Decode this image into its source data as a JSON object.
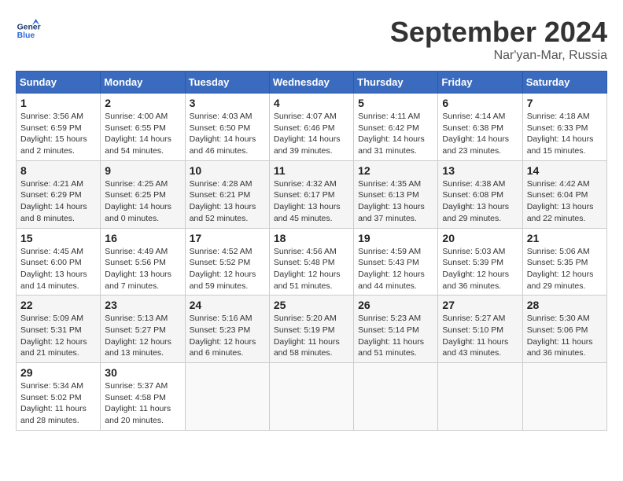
{
  "logo": {
    "text_general": "General",
    "text_blue": "Blue"
  },
  "header": {
    "month": "September 2024",
    "location": "Nar'yan-Mar, Russia"
  },
  "days_of_week": [
    "Sunday",
    "Monday",
    "Tuesday",
    "Wednesday",
    "Thursday",
    "Friday",
    "Saturday"
  ],
  "weeks": [
    [
      {
        "day": "1",
        "sunrise": "Sunrise: 3:56 AM",
        "sunset": "Sunset: 6:59 PM",
        "daylight": "Daylight: 15 hours and 2 minutes."
      },
      {
        "day": "2",
        "sunrise": "Sunrise: 4:00 AM",
        "sunset": "Sunset: 6:55 PM",
        "daylight": "Daylight: 14 hours and 54 minutes."
      },
      {
        "day": "3",
        "sunrise": "Sunrise: 4:03 AM",
        "sunset": "Sunset: 6:50 PM",
        "daylight": "Daylight: 14 hours and 46 minutes."
      },
      {
        "day": "4",
        "sunrise": "Sunrise: 4:07 AM",
        "sunset": "Sunset: 6:46 PM",
        "daylight": "Daylight: 14 hours and 39 minutes."
      },
      {
        "day": "5",
        "sunrise": "Sunrise: 4:11 AM",
        "sunset": "Sunset: 6:42 PM",
        "daylight": "Daylight: 14 hours and 31 minutes."
      },
      {
        "day": "6",
        "sunrise": "Sunrise: 4:14 AM",
        "sunset": "Sunset: 6:38 PM",
        "daylight": "Daylight: 14 hours and 23 minutes."
      },
      {
        "day": "7",
        "sunrise": "Sunrise: 4:18 AM",
        "sunset": "Sunset: 6:33 PM",
        "daylight": "Daylight: 14 hours and 15 minutes."
      }
    ],
    [
      {
        "day": "8",
        "sunrise": "Sunrise: 4:21 AM",
        "sunset": "Sunset: 6:29 PM",
        "daylight": "Daylight: 14 hours and 8 minutes."
      },
      {
        "day": "9",
        "sunrise": "Sunrise: 4:25 AM",
        "sunset": "Sunset: 6:25 PM",
        "daylight": "Daylight: 14 hours and 0 minutes."
      },
      {
        "day": "10",
        "sunrise": "Sunrise: 4:28 AM",
        "sunset": "Sunset: 6:21 PM",
        "daylight": "Daylight: 13 hours and 52 minutes."
      },
      {
        "day": "11",
        "sunrise": "Sunrise: 4:32 AM",
        "sunset": "Sunset: 6:17 PM",
        "daylight": "Daylight: 13 hours and 45 minutes."
      },
      {
        "day": "12",
        "sunrise": "Sunrise: 4:35 AM",
        "sunset": "Sunset: 6:13 PM",
        "daylight": "Daylight: 13 hours and 37 minutes."
      },
      {
        "day": "13",
        "sunrise": "Sunrise: 4:38 AM",
        "sunset": "Sunset: 6:08 PM",
        "daylight": "Daylight: 13 hours and 29 minutes."
      },
      {
        "day": "14",
        "sunrise": "Sunrise: 4:42 AM",
        "sunset": "Sunset: 6:04 PM",
        "daylight": "Daylight: 13 hours and 22 minutes."
      }
    ],
    [
      {
        "day": "15",
        "sunrise": "Sunrise: 4:45 AM",
        "sunset": "Sunset: 6:00 PM",
        "daylight": "Daylight: 13 hours and 14 minutes."
      },
      {
        "day": "16",
        "sunrise": "Sunrise: 4:49 AM",
        "sunset": "Sunset: 5:56 PM",
        "daylight": "Daylight: 13 hours and 7 minutes."
      },
      {
        "day": "17",
        "sunrise": "Sunrise: 4:52 AM",
        "sunset": "Sunset: 5:52 PM",
        "daylight": "Daylight: 12 hours and 59 minutes."
      },
      {
        "day": "18",
        "sunrise": "Sunrise: 4:56 AM",
        "sunset": "Sunset: 5:48 PM",
        "daylight": "Daylight: 12 hours and 51 minutes."
      },
      {
        "day": "19",
        "sunrise": "Sunrise: 4:59 AM",
        "sunset": "Sunset: 5:43 PM",
        "daylight": "Daylight: 12 hours and 44 minutes."
      },
      {
        "day": "20",
        "sunrise": "Sunrise: 5:03 AM",
        "sunset": "Sunset: 5:39 PM",
        "daylight": "Daylight: 12 hours and 36 minutes."
      },
      {
        "day": "21",
        "sunrise": "Sunrise: 5:06 AM",
        "sunset": "Sunset: 5:35 PM",
        "daylight": "Daylight: 12 hours and 29 minutes."
      }
    ],
    [
      {
        "day": "22",
        "sunrise": "Sunrise: 5:09 AM",
        "sunset": "Sunset: 5:31 PM",
        "daylight": "Daylight: 12 hours and 21 minutes."
      },
      {
        "day": "23",
        "sunrise": "Sunrise: 5:13 AM",
        "sunset": "Sunset: 5:27 PM",
        "daylight": "Daylight: 12 hours and 13 minutes."
      },
      {
        "day": "24",
        "sunrise": "Sunrise: 5:16 AM",
        "sunset": "Sunset: 5:23 PM",
        "daylight": "Daylight: 12 hours and 6 minutes."
      },
      {
        "day": "25",
        "sunrise": "Sunrise: 5:20 AM",
        "sunset": "Sunset: 5:19 PM",
        "daylight": "Daylight: 11 hours and 58 minutes."
      },
      {
        "day": "26",
        "sunrise": "Sunrise: 5:23 AM",
        "sunset": "Sunset: 5:14 PM",
        "daylight": "Daylight: 11 hours and 51 minutes."
      },
      {
        "day": "27",
        "sunrise": "Sunrise: 5:27 AM",
        "sunset": "Sunset: 5:10 PM",
        "daylight": "Daylight: 11 hours and 43 minutes."
      },
      {
        "day": "28",
        "sunrise": "Sunrise: 5:30 AM",
        "sunset": "Sunset: 5:06 PM",
        "daylight": "Daylight: 11 hours and 36 minutes."
      }
    ],
    [
      {
        "day": "29",
        "sunrise": "Sunrise: 5:34 AM",
        "sunset": "Sunset: 5:02 PM",
        "daylight": "Daylight: 11 hours and 28 minutes."
      },
      {
        "day": "30",
        "sunrise": "Sunrise: 5:37 AM",
        "sunset": "Sunset: 4:58 PM",
        "daylight": "Daylight: 11 hours and 20 minutes."
      },
      null,
      null,
      null,
      null,
      null
    ]
  ]
}
